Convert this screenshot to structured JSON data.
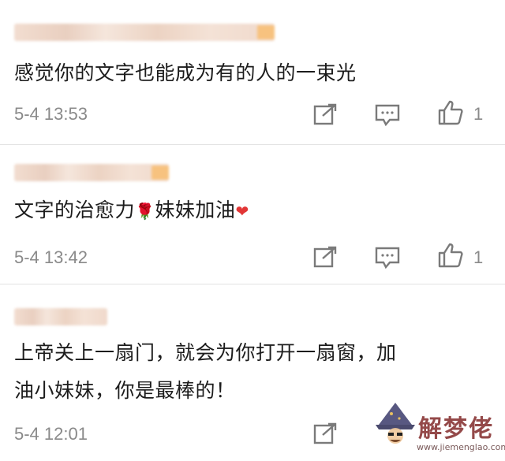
{
  "comments": [
    {
      "text": "感觉你的文字也能成为有的人的一束光",
      "timestamp": "5-4 13:53",
      "likes": "1"
    },
    {
      "text": "文字的治愈力",
      "text_after": "妹妹加油",
      "emoji_rose": "🌹",
      "emoji_heart": "❤",
      "timestamp": "5-4 13:42",
      "likes": "1"
    },
    {
      "line1": "上帝关上一扇门，就会为你打开一扇窗，加",
      "line2": "油小妹妹，你是最棒的！",
      "timestamp": "5-4 12:01"
    }
  ],
  "watermark": {
    "title": "解梦佬",
    "url": "www.jiemenglao.com"
  },
  "icons": {
    "share": "share-edit-icon",
    "reply": "comment-bubble-icon",
    "like": "thumbs-up-icon"
  },
  "colors": {
    "text": "#1c1c1c",
    "meta": "#8a8a8a",
    "divider": "#e3e3e3"
  }
}
